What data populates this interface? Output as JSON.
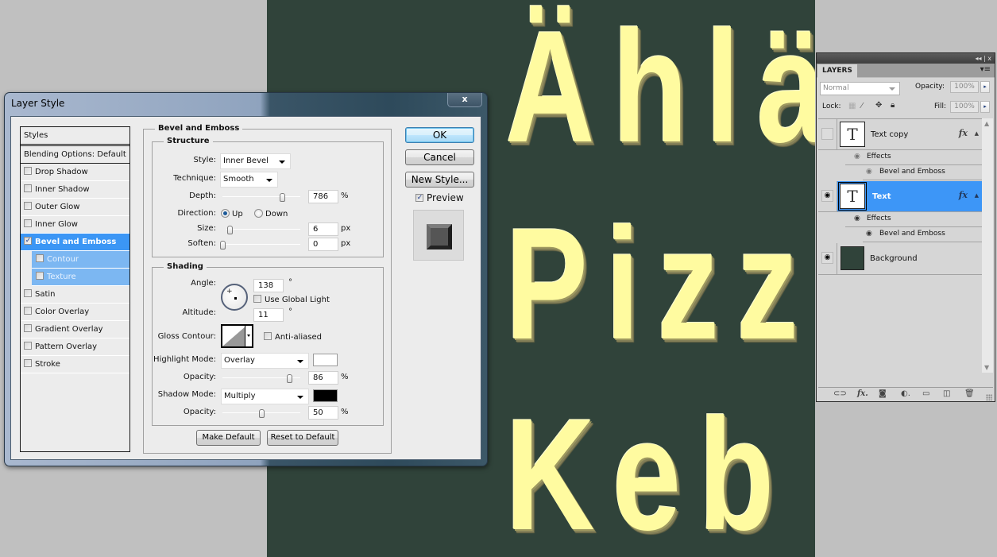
{
  "canvas": {
    "background_color": "#30433a",
    "text_color": "#fffba0",
    "lines": [
      "Ählä",
      "Pizz",
      "Keb"
    ]
  },
  "dialog": {
    "title": "Layer Style",
    "close_label": "x",
    "styles_header": "Styles",
    "blending_options": "Blending Options: Default",
    "style_items": [
      {
        "label": "Drop Shadow",
        "checked": false
      },
      {
        "label": "Inner Shadow",
        "checked": false
      },
      {
        "label": "Outer Glow",
        "checked": false
      },
      {
        "label": "Inner Glow",
        "checked": false
      },
      {
        "label": "Bevel and Emboss",
        "checked": true,
        "active": true
      },
      {
        "label": "Contour",
        "checked": false,
        "sub": true
      },
      {
        "label": "Texture",
        "checked": false,
        "sub": true
      },
      {
        "label": "Satin",
        "checked": false
      },
      {
        "label": "Color Overlay",
        "checked": false
      },
      {
        "label": "Gradient Overlay",
        "checked": false
      },
      {
        "label": "Pattern Overlay",
        "checked": false
      },
      {
        "label": "Stroke",
        "checked": false
      }
    ],
    "bevel": {
      "section_title": "Bevel and Emboss",
      "structure": {
        "title": "Structure",
        "style_label": "Style:",
        "style_value": "Inner Bevel",
        "technique_label": "Technique:",
        "technique_value": "Smooth",
        "depth_label": "Depth:",
        "depth_value": "786",
        "depth_unit": "%",
        "depth_slider_fraction": 0.77,
        "direction_label": "Direction:",
        "direction_up": "Up",
        "direction_down": "Down",
        "direction_selected": "Up",
        "size_label": "Size:",
        "size_value": "6",
        "size_unit": "px",
        "size_slider_fraction": 0.04,
        "soften_label": "Soften:",
        "soften_value": "0",
        "soften_unit": "px",
        "soften_slider_fraction": 0.0
      },
      "shading": {
        "title": "Shading",
        "angle_label": "Angle:",
        "angle_value": "138",
        "angle_unit": "°",
        "use_global_light_label": "Use Global Light",
        "use_global_light": false,
        "altitude_label": "Altitude:",
        "altitude_value": "11",
        "altitude_unit": "°",
        "gloss_contour_label": "Gloss Contour:",
        "anti_aliased_label": "Anti-aliased",
        "anti_aliased": false,
        "highlight_mode_label": "Highlight Mode:",
        "highlight_mode_value": "Overlay",
        "highlight_color": "#ffffff",
        "highlight_opacity_label": "Opacity:",
        "highlight_opacity_value": "86",
        "highlight_opacity_unit": "%",
        "highlight_opacity_fraction": 0.86,
        "shadow_mode_label": "Shadow Mode:",
        "shadow_mode_value": "Multiply",
        "shadow_color": "#000000",
        "shadow_opacity_label": "Opacity:",
        "shadow_opacity_value": "50",
        "shadow_opacity_unit": "%",
        "shadow_opacity_fraction": 0.5
      },
      "make_default_label": "Make Default",
      "reset_default_label": "Reset to Default"
    },
    "buttons": {
      "ok": "OK",
      "cancel": "Cancel",
      "new_style": "New Style...",
      "preview_label": "Preview",
      "preview_checked": true
    }
  },
  "layers_panel": {
    "tab_label": "LAYERS",
    "collapse_icon": "double-chevron-icon",
    "close_label": "x",
    "blend_mode": "Normal",
    "opacity_label": "Opacity:",
    "opacity_value": "100%",
    "lock_label": "Lock:",
    "fill_label": "Fill:",
    "fill_value": "100%",
    "layers": [
      {
        "name": "Text copy",
        "type": "text",
        "visible": false,
        "selected": false,
        "has_fx": true,
        "effects_label": "Effects",
        "effects": [
          "Bevel and Emboss"
        ]
      },
      {
        "name": "Text",
        "type": "text",
        "visible": true,
        "selected": true,
        "has_fx": true,
        "effects_label": "Effects",
        "effects": [
          "Bevel and Emboss"
        ]
      },
      {
        "name": "Background",
        "type": "image",
        "visible": true,
        "selected": false,
        "has_fx": false
      }
    ],
    "footer_icons": [
      "link-layers-icon",
      "fx-icon",
      "add-mask-icon",
      "adjustment-layer-icon",
      "new-group-icon",
      "new-layer-icon",
      "trash-icon"
    ]
  }
}
